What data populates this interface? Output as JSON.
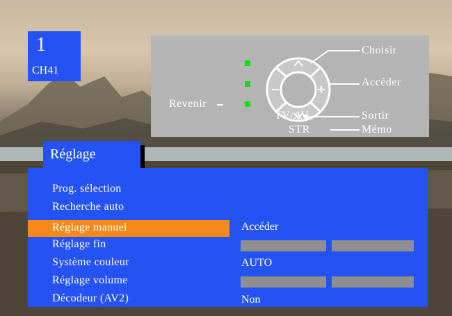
{
  "channel": {
    "number": "1",
    "name": "CH41"
  },
  "remote": {
    "labels": {
      "choose": "Choisir",
      "access": "Accéder",
      "back": "Revenir",
      "tvav": "TV/AV",
      "exit": "Sortir",
      "str": "STR",
      "memo": "Mémo"
    },
    "led_color": "#17d817"
  },
  "menu": {
    "title": "Réglage",
    "items": [
      {
        "label": "Prog. sélection",
        "value": ""
      },
      {
        "label": "Recherche auto",
        "value": ""
      },
      {
        "label": "Réglage manuel",
        "value": "Accéder",
        "selected": true
      },
      {
        "label": "Réglage fin",
        "value": ""
      },
      {
        "label": "Système couleur",
        "value": "AUTO"
      },
      {
        "label": "Réglage volume",
        "value": ""
      },
      {
        "label": "Décodeur (AV2)",
        "value": "Non"
      }
    ]
  },
  "colors": {
    "menu_bg": "#2553f3",
    "highlight": "#f58a1a",
    "panel_bg": "#b4b4b4",
    "bar": "#8f8f8f"
  }
}
